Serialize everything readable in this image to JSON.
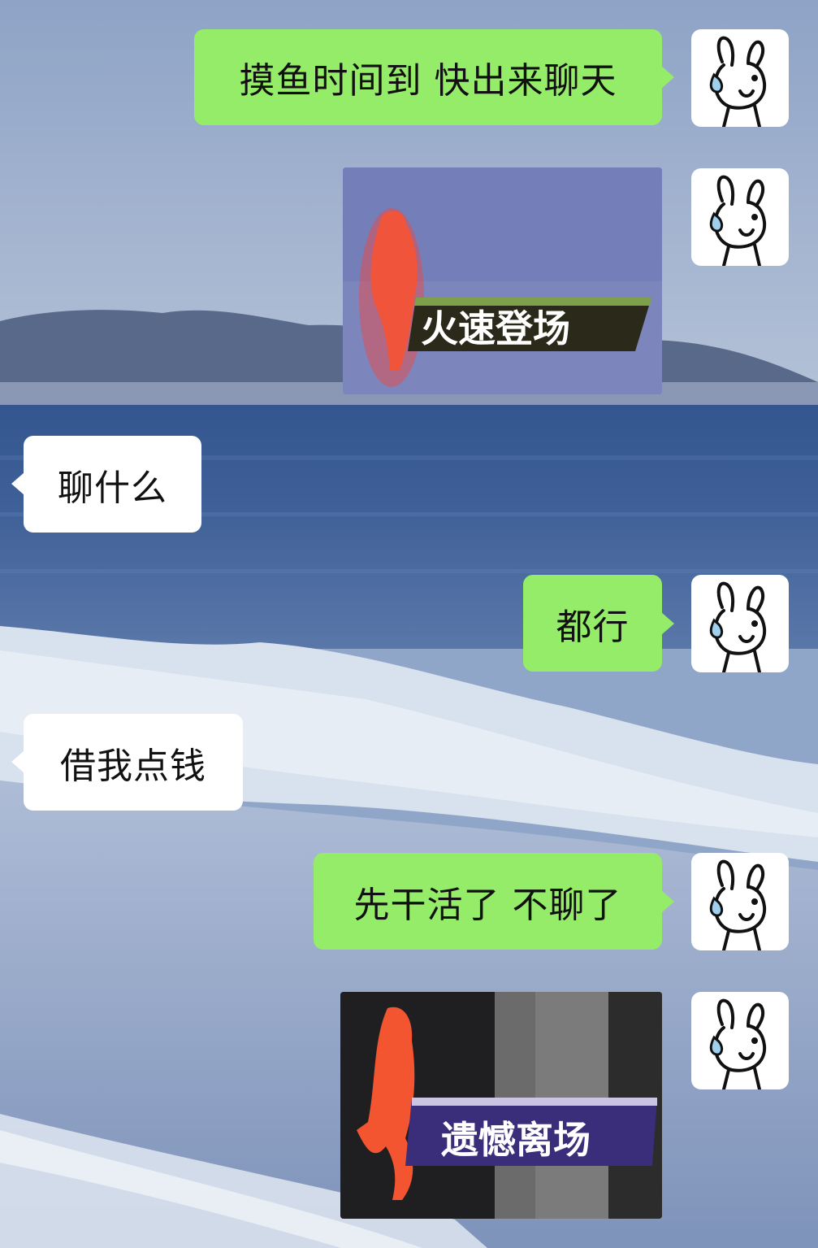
{
  "messages": [
    {
      "side": "out",
      "type": "text",
      "text": "摸鱼时间到 快出来聊天"
    },
    {
      "side": "out",
      "type": "sticker",
      "text": "火速登场"
    },
    {
      "side": "in",
      "type": "text",
      "text": "聊什么"
    },
    {
      "side": "out",
      "type": "text",
      "text": "都行"
    },
    {
      "side": "in",
      "type": "text",
      "text": "借我点钱"
    },
    {
      "side": "out",
      "type": "text",
      "text": "先干活了 不聊了"
    },
    {
      "side": "out",
      "type": "sticker",
      "text": "遗憾离场"
    }
  ],
  "avatar": {
    "icon": "bunny-sweat-icon"
  },
  "colors": {
    "out_bubble": "#95ec69",
    "in_bubble": "#ffffff"
  }
}
